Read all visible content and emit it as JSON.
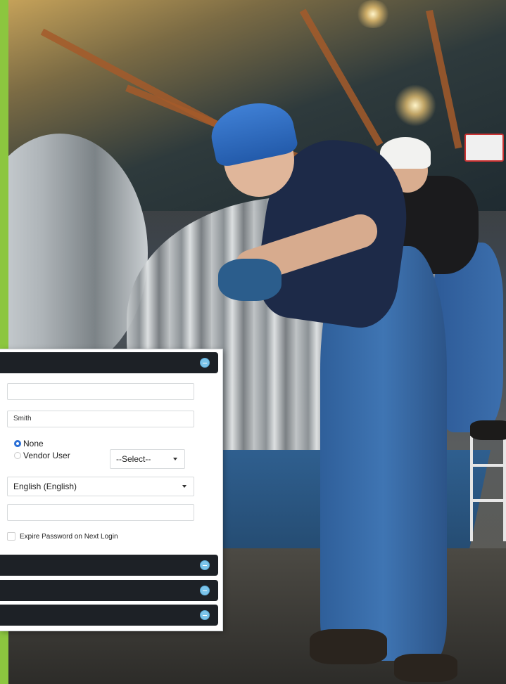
{
  "form": {
    "surname_value": "Smith",
    "user_type_options": [
      {
        "label": "None",
        "selected": true
      },
      {
        "label": "Vendor User",
        "selected": false
      }
    ],
    "vendor_select_value": "--Select--",
    "language_value": "English (English)",
    "expire_password_label": "Expire Password on Next Login",
    "expire_password_checked": false
  },
  "colors": {
    "accent_strip": "#8cc63f",
    "section_bar": "#1d2126",
    "toggle_icon": "#7bc4ea",
    "radio_selected": "#2a6fd6"
  },
  "icons": {
    "section_toggle": "minus-circle-icon",
    "dropdown": "caret-down-icon"
  }
}
